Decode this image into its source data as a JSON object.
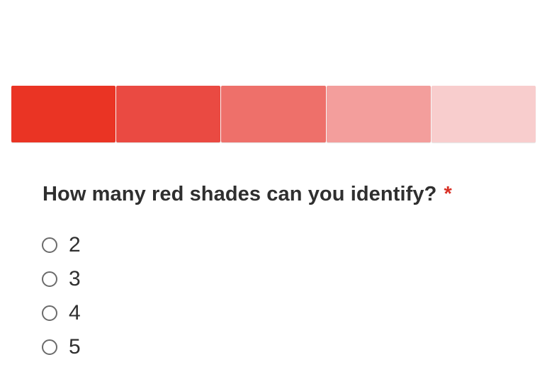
{
  "swatches": [
    {
      "name": "shade-1",
      "color": "#ea3424"
    },
    {
      "name": "shade-2",
      "color": "#ea4a42"
    },
    {
      "name": "shade-3",
      "color": "#ee706a"
    },
    {
      "name": "shade-4",
      "color": "#f39e9c"
    },
    {
      "name": "shade-5",
      "color": "#f8cdcd"
    }
  ],
  "question": {
    "text": "How many red shades can you identify?",
    "required_marker": "*"
  },
  "options": [
    {
      "label": "2",
      "selected": false
    },
    {
      "label": "3",
      "selected": false
    },
    {
      "label": "4",
      "selected": false
    },
    {
      "label": "5",
      "selected": false
    }
  ],
  "colors": {
    "required": "#d93025",
    "text": "#2f2f2f",
    "radio_border": "#6b6b6b"
  }
}
